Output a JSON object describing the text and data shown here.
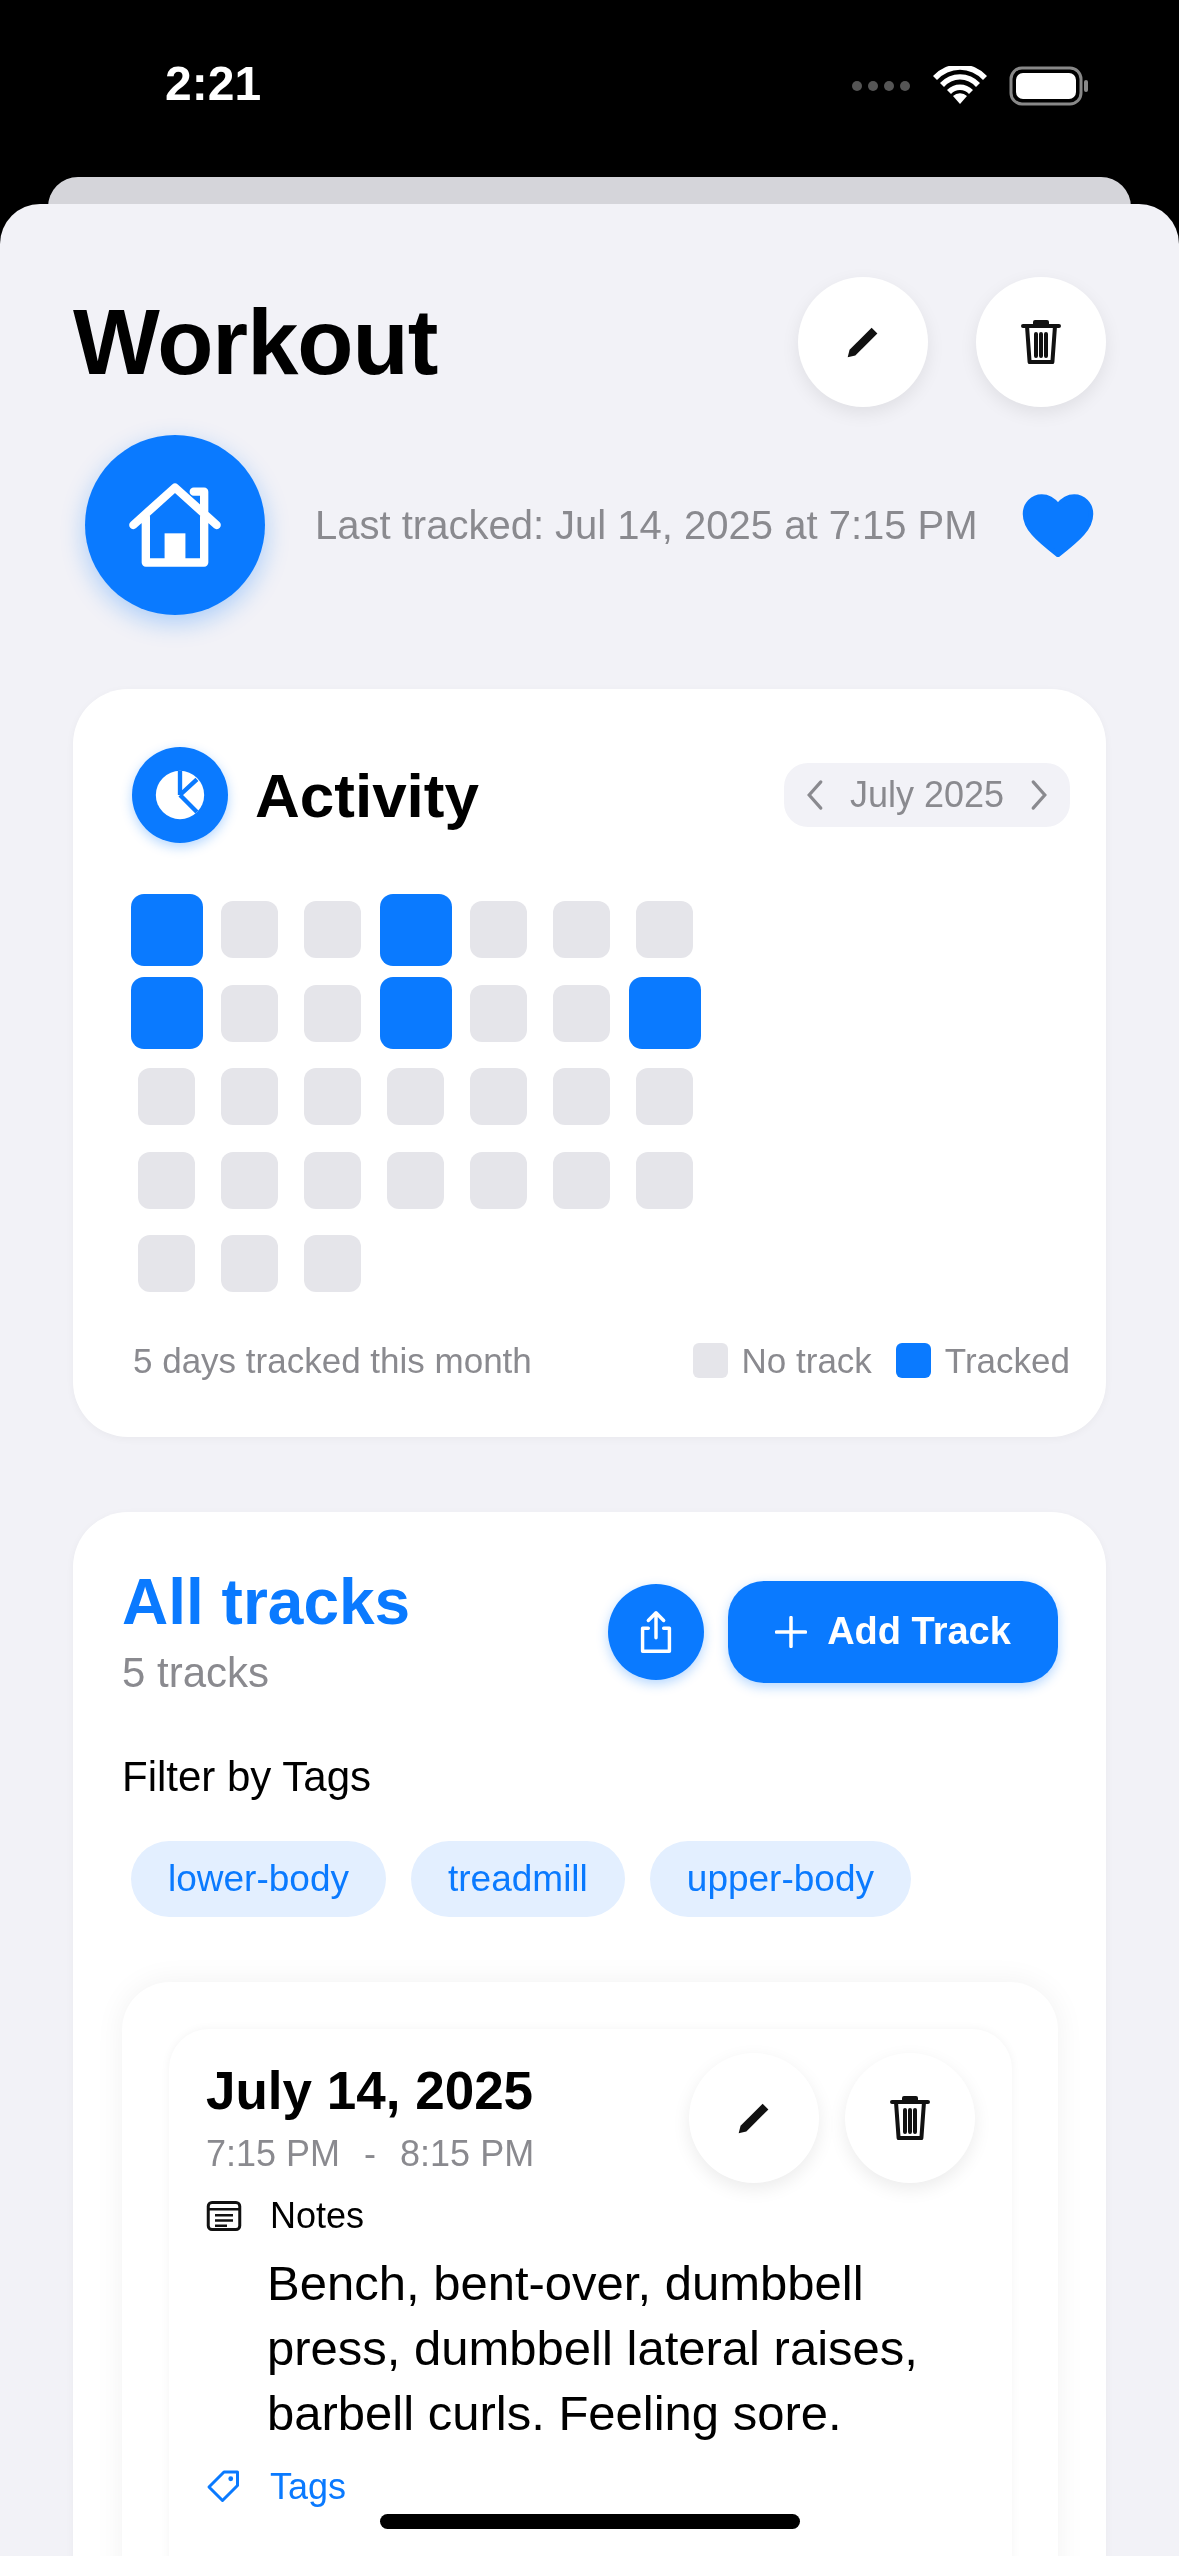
{
  "status_bar": {
    "time": "2:21"
  },
  "header": {
    "title": "Workout",
    "last_tracked": "Last tracked: Jul 14, 2025 at 7:15 PM",
    "favorite": true
  },
  "activity": {
    "title": "Activity",
    "month": "July 2025",
    "days": [
      {
        "tracked": true
      },
      {
        "tracked": false
      },
      {
        "tracked": false
      },
      {
        "tracked": true
      },
      {
        "tracked": false
      },
      {
        "tracked": false
      },
      {
        "tracked": false
      },
      {
        "tracked": true
      },
      {
        "tracked": false
      },
      {
        "tracked": false
      },
      {
        "tracked": true
      },
      {
        "tracked": false
      },
      {
        "tracked": false
      },
      {
        "tracked": true
      },
      {
        "tracked": false
      },
      {
        "tracked": false
      },
      {
        "tracked": false
      },
      {
        "tracked": false
      },
      {
        "tracked": false
      },
      {
        "tracked": false
      },
      {
        "tracked": false
      },
      {
        "tracked": false
      },
      {
        "tracked": false
      },
      {
        "tracked": false
      },
      {
        "tracked": false
      },
      {
        "tracked": false
      },
      {
        "tracked": false
      },
      {
        "tracked": false
      },
      {
        "tracked": false
      },
      {
        "tracked": false
      },
      {
        "tracked": false
      }
    ],
    "summary": "5 days tracked this month",
    "legend": [
      {
        "label": "No track",
        "tracked": false
      },
      {
        "label": "Tracked",
        "tracked": true
      }
    ]
  },
  "tracks": {
    "title": "All tracks",
    "count": "5 tracks",
    "add_button": "Add Track",
    "filter_label": "Filter by Tags",
    "tags": [
      {
        "label": "lower-body",
        "selected": false
      },
      {
        "label": "treadmill",
        "selected": false
      },
      {
        "label": "upper-body",
        "selected": false
      }
    ],
    "entries": [
      {
        "date": "July 14, 2025",
        "start": "7:15 PM",
        "separator": "-",
        "end": "8:15 PM",
        "notes_label": "Notes",
        "notes": "Bench, bent-over, dumbbell press, dumbbell lateral raises, barbell curls. Feeling sore.",
        "tags_label": "Tags"
      }
    ]
  }
}
